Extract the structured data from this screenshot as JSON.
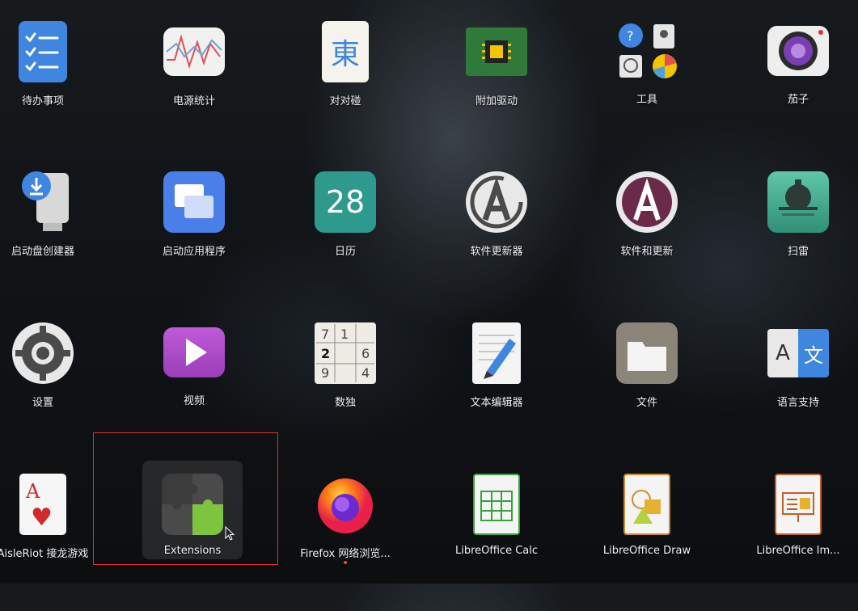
{
  "apps": [
    {
      "name": "todo",
      "label": "待办事项"
    },
    {
      "name": "power-stats",
      "label": "电源统计"
    },
    {
      "name": "mahjong",
      "label": "对对碰",
      "glyph": "東"
    },
    {
      "name": "additional-drivers",
      "label": "附加驱动"
    },
    {
      "name": "utilities",
      "label": "工具"
    },
    {
      "name": "cheese",
      "label": "茄子"
    },
    {
      "name": "startup-disk-creator",
      "label": "启动盘创建器"
    },
    {
      "name": "startup-applications",
      "label": "启动应用程序"
    },
    {
      "name": "calendar",
      "label": "日历",
      "glyph": "28"
    },
    {
      "name": "software-updater",
      "label": "软件更新器"
    },
    {
      "name": "software-updates",
      "label": "软件和更新"
    },
    {
      "name": "mines",
      "label": "扫雷"
    },
    {
      "name": "settings",
      "label": "设置"
    },
    {
      "name": "videos",
      "label": "视频"
    },
    {
      "name": "sudoku",
      "label": "数独",
      "digits": [
        "7",
        "1",
        "2",
        "6",
        "9",
        "4"
      ]
    },
    {
      "name": "text-editor",
      "label": "文本编辑器"
    },
    {
      "name": "files",
      "label": "文件"
    },
    {
      "name": "language-support",
      "label": "语言支持",
      "glyph_a": "A",
      "glyph_b": "文"
    },
    {
      "name": "aisleriot",
      "label": "AisleRiot 接龙游戏",
      "glyph": "A",
      "suit": "♥"
    },
    {
      "name": "extensions",
      "label": "Extensions"
    },
    {
      "name": "firefox",
      "label": "Firefox 网络浏览..."
    },
    {
      "name": "libreoffice-calc",
      "label": "LibreOffice Calc"
    },
    {
      "name": "libreoffice-draw",
      "label": "LibreOffice Draw"
    },
    {
      "name": "libreoffice-impress",
      "label": "LibreOffice Im..."
    }
  ],
  "utilities_glyph": "?",
  "colors": {
    "highlight": "#e03030",
    "running_dot": "#e95420"
  }
}
